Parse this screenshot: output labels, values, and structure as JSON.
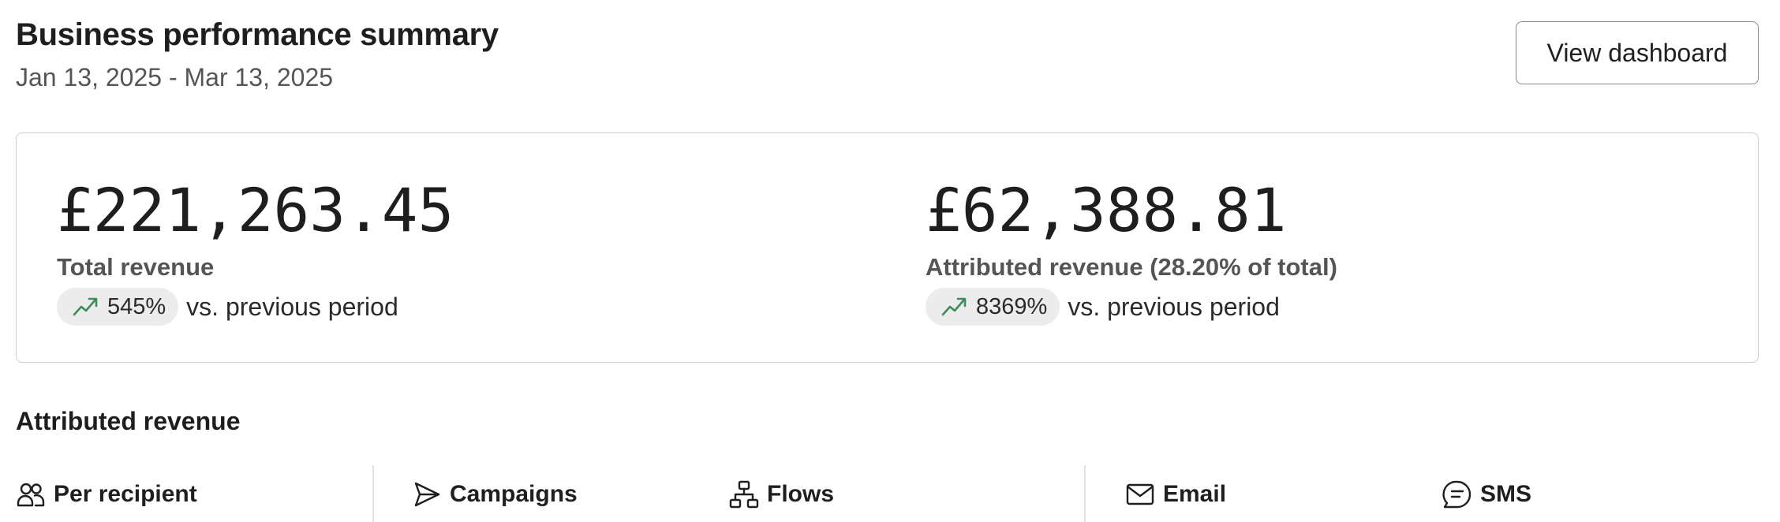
{
  "header": {
    "title": "Business performance summary",
    "date_range": "Jan 13, 2025 - Mar 13, 2025",
    "view_dashboard_label": "View dashboard"
  },
  "summary": {
    "total": {
      "value": "£221,263.45",
      "label": "Total revenue",
      "change": "545%",
      "change_suffix": "vs. previous period",
      "trend_icon": "trend-up-icon"
    },
    "attributed": {
      "value": "£62,388.81",
      "label": "Attributed revenue (28.20% of total)",
      "change": "8369%",
      "change_suffix": "vs. previous period",
      "trend_icon": "trend-up-icon"
    }
  },
  "colors": {
    "trend_up": "#3d8c5a",
    "pill_bg": "#ececec",
    "border": "#cfcfcf"
  },
  "attributed_section": {
    "title": "Attributed revenue",
    "tabs": [
      {
        "label": "Per recipient",
        "icon": "users-icon"
      },
      {
        "label": "Campaigns",
        "icon": "send-icon"
      },
      {
        "label": "Flows",
        "icon": "flows-icon"
      },
      {
        "label": "Email",
        "icon": "mail-icon"
      },
      {
        "label": "SMS",
        "icon": "sms-icon"
      }
    ]
  }
}
